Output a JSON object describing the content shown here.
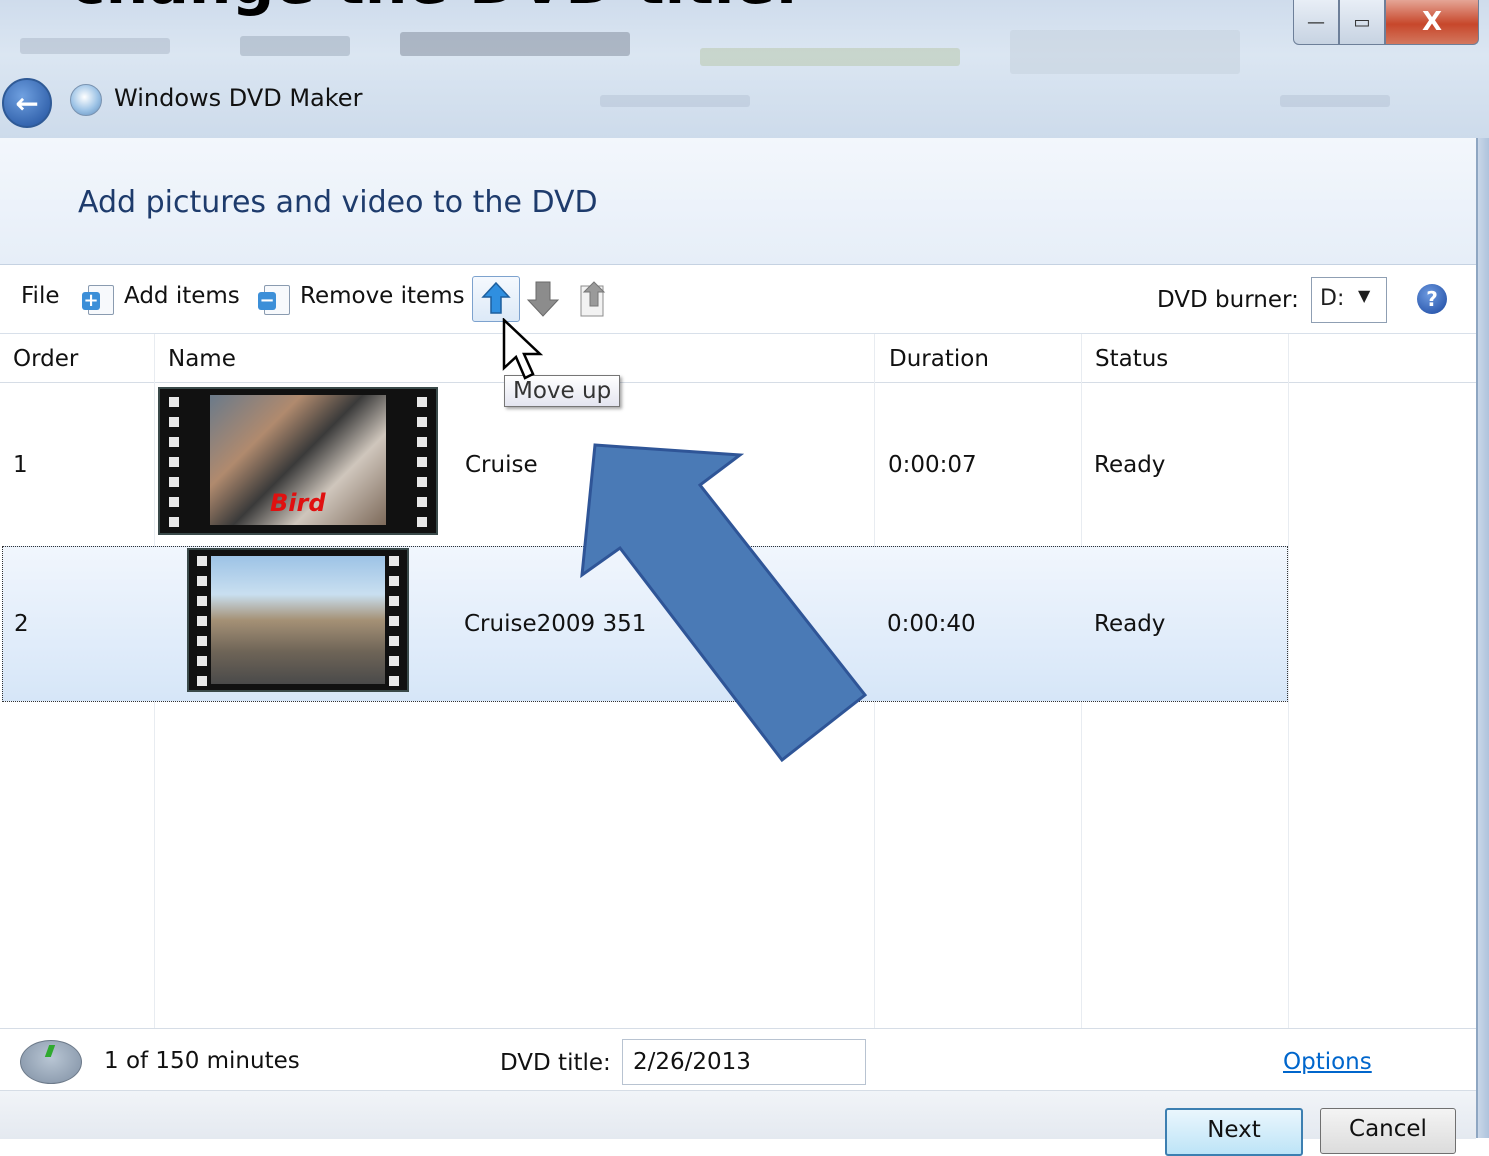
{
  "slide_heading": "change the DVD title.",
  "window": {
    "title": "Windows DVD Maker",
    "controls": {
      "minimize": "—",
      "maximize": "▭",
      "close": "X"
    }
  },
  "page_heading": "Add pictures and video to the DVD",
  "toolbar": {
    "file": "File",
    "add_items": "Add items",
    "remove_items": "Remove items",
    "dvd_burner_label": "DVD burner:",
    "dvd_burner_value": "D:"
  },
  "tooltip": "Move up",
  "columns": {
    "order": "Order",
    "name": "Name",
    "duration": "Duration",
    "status": "Status"
  },
  "rows": [
    {
      "order": "1",
      "name": "Cruise",
      "duration": "0:00:07",
      "status": "Ready",
      "caption": "Bird"
    },
    {
      "order": "2",
      "name": "Cruise2009 351",
      "duration": "0:00:40",
      "status": "Ready"
    }
  ],
  "footer": {
    "minutes": "1 of 150 minutes",
    "dvd_title_label": "DVD title:",
    "dvd_title_value": "2/26/2013",
    "options": "Options"
  },
  "buttons": {
    "next": "Next",
    "cancel": "Cancel"
  },
  "colors": {
    "accent_arrow": "#4a7ab6",
    "link": "#0066cc",
    "heading": "#1e3b6c"
  }
}
